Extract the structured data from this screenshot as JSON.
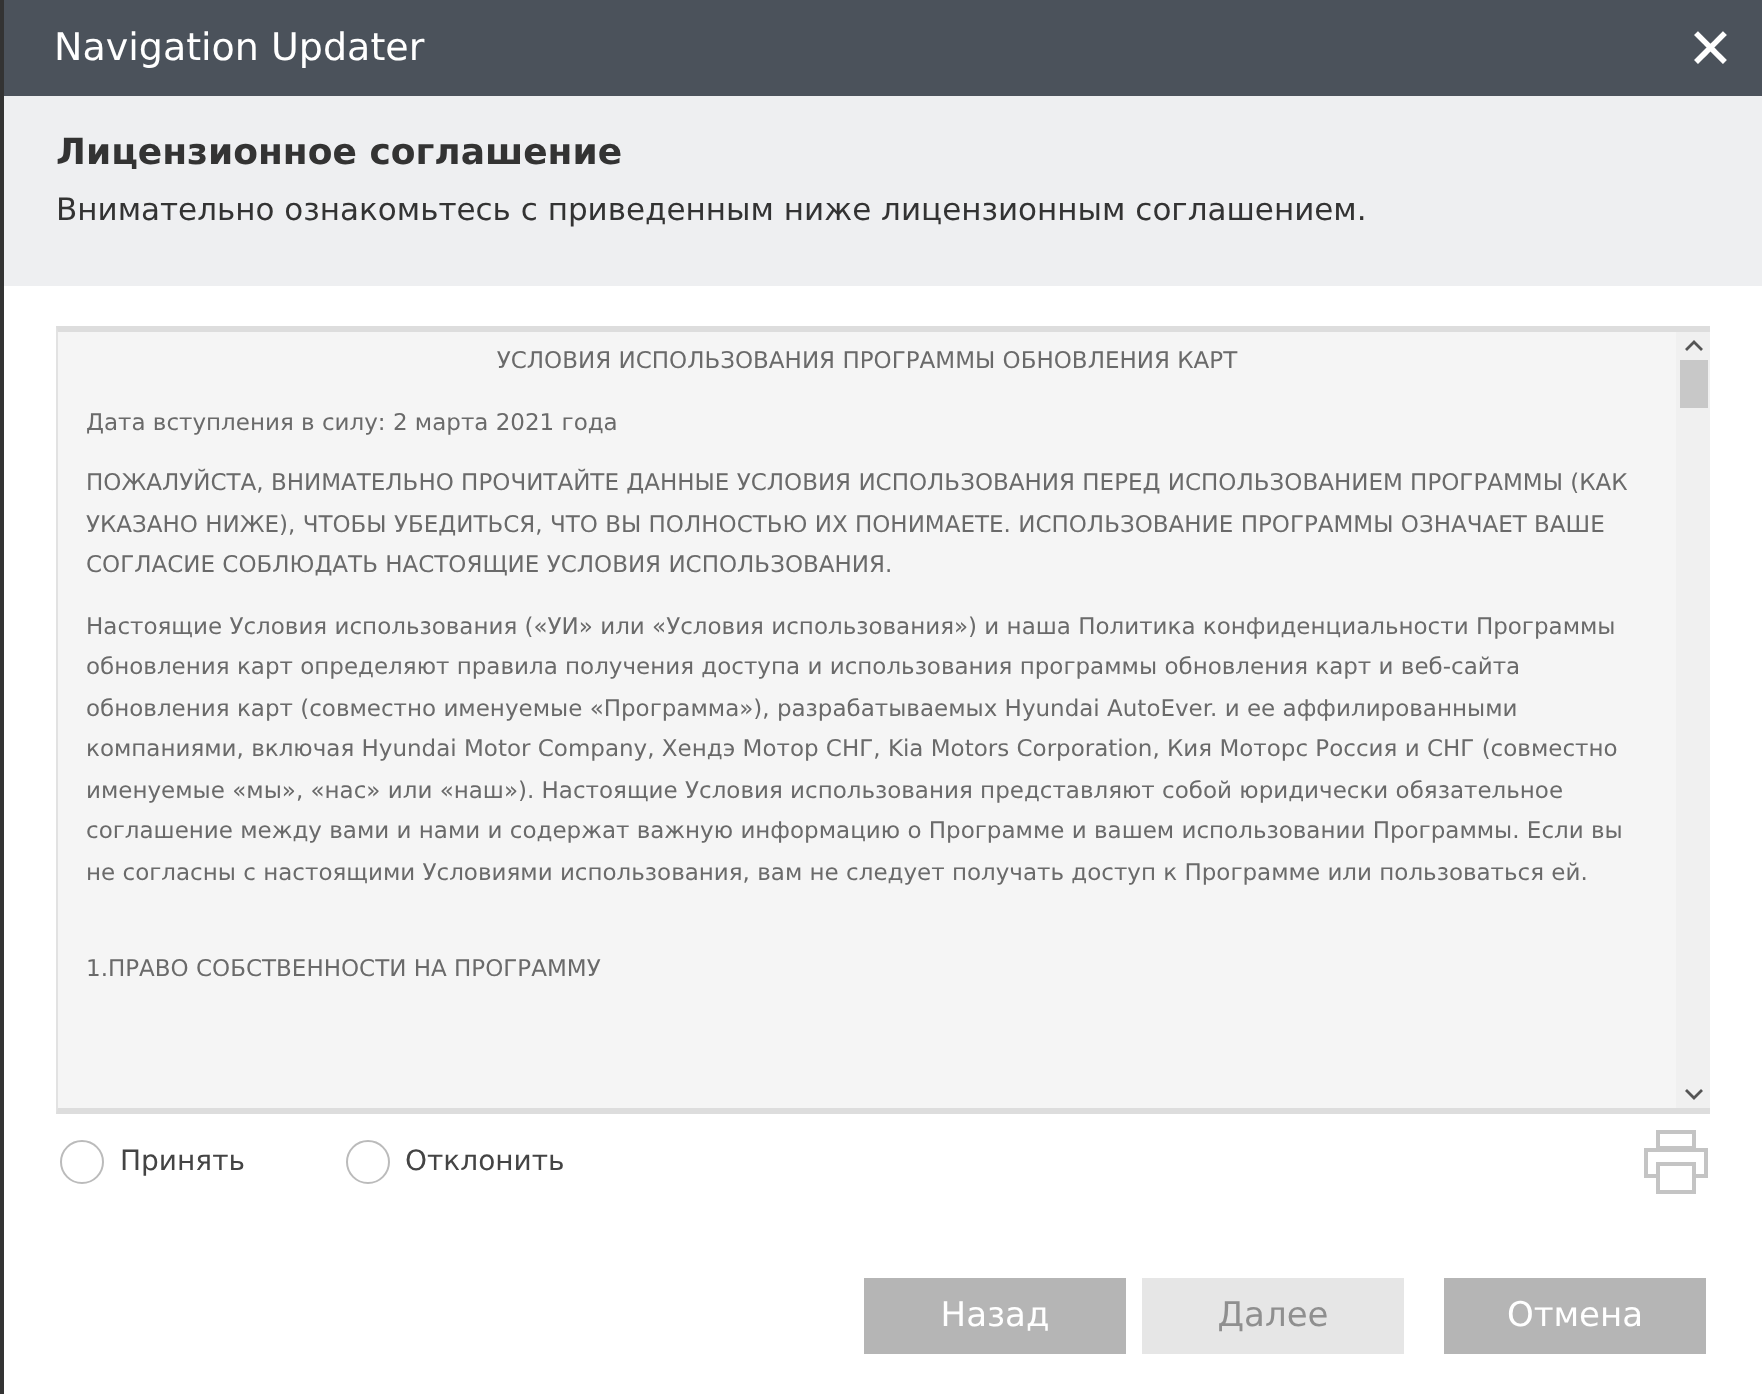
{
  "window": {
    "title": "Navigation Updater",
    "close": "✕"
  },
  "header": {
    "title": "Лицензионное соглашение",
    "subtitle": "Внимательно ознакомьтесь с приведенным ниже лицензионным соглашением."
  },
  "agreement": {
    "heading": "УСЛОВИЯ ИСПОЛЬЗОВАНИЯ ПРОГРАММЫ ОБНОВЛЕНИЯ КАРТ",
    "paragraphs": [
      "Дата вступления в силу: 2 марта 2021 года",
      "ПОЖАЛУЙСТА, ВНИМАТЕЛЬНО ПРОЧИТАЙТЕ ДАННЫЕ УСЛОВИЯ ИСПОЛЬЗОВАНИЯ ПЕРЕД ИСПОЛЬЗОВАНИЕМ ПРОГРАММЫ (КАК УКАЗАНО НИЖЕ), ЧТОБЫ УБЕДИТЬСЯ, ЧТО ВЫ ПОЛНОСТЬЮ ИХ ПОНИМАЕТЕ. ИСПОЛЬЗОВАНИЕ ПРОГРАММЫ ОЗНАЧАЕТ ВАШЕ СОГЛАСИЕ СОБЛЮДАТЬ НАСТОЯЩИЕ УСЛОВИЯ ИСПОЛЬЗОВАНИЯ.",
      "Настоящие Условия использования («УИ» или «Условия использования») и наша Политика конфиденциальности Программы обновления карт определяют правила получения доступа и использования программы обновления карт и веб-сайта обновления карт (совместно именуемые «Программа»), разрабатываемых Hyundai AutoEver. и ее аффилированными компаниями, включая Hyundai Motor Company, Хендэ Мотор СНГ, Kia Motors Corporation, Кия Моторс Россия и СНГ (совместно именуемые «мы», «нас» или «наш»). Настоящие Условия использования представляют собой юридически обязательное соглашение между вами и нами и содержат важную информацию о Программе и вашем использовании Программы. Если вы не согласны с настоящими Условиями использования, вам не следует получать доступ к Программе или пользоваться ей."
    ],
    "section": "1.ПРАВО СОБСТВЕННОСТИ НА ПРОГРАММУ"
  },
  "choices": [
    {
      "label": "Принять",
      "selected": false
    },
    {
      "label": "Отклонить",
      "selected": false
    }
  ],
  "buttons": [
    {
      "label": "Назад",
      "disabled": false
    },
    {
      "label": "Далее",
      "disabled": true
    },
    {
      "label": "Отмена",
      "disabled": false
    }
  ]
}
